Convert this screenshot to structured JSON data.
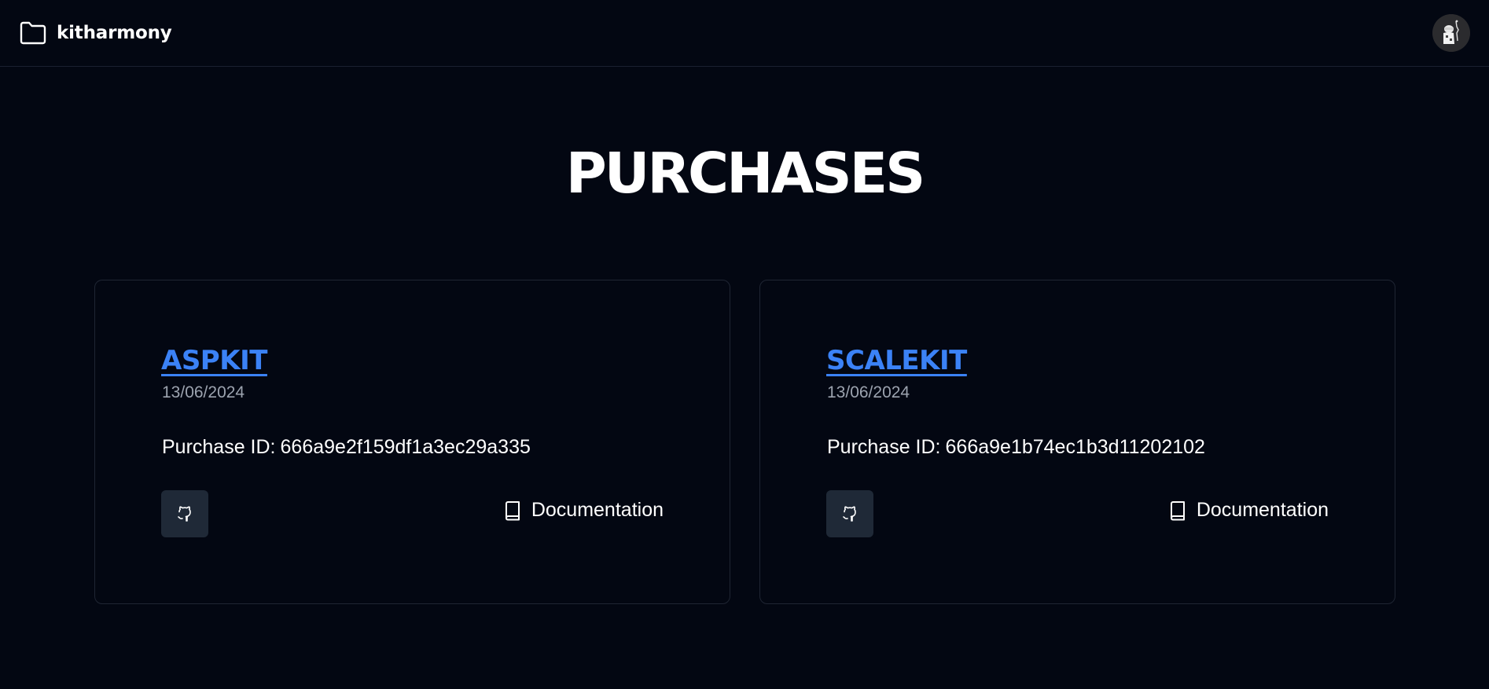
{
  "header": {
    "brand_name": "kitharmony",
    "brand_icon": "folder-icon",
    "avatar_icon": "user-avatar"
  },
  "main": {
    "title": "PURCHASES"
  },
  "purchases": [
    {
      "name": "ASPKIT",
      "date": "13/06/2024",
      "id_label": "Purchase ID:",
      "id_value": "666a9e2f159df1a3ec29a335",
      "docs_label": "Documentation"
    },
    {
      "name": "SCALEKIT",
      "date": "13/06/2024",
      "id_label": "Purchase ID:",
      "id_value": "666a9e1b74ec1b3d11202102",
      "docs_label": "Documentation"
    }
  ],
  "colors": {
    "background": "#030712",
    "accent": "#3b82f6",
    "muted": "#9ca3af",
    "button_bg": "#1f2937",
    "border": "#1f2533"
  }
}
